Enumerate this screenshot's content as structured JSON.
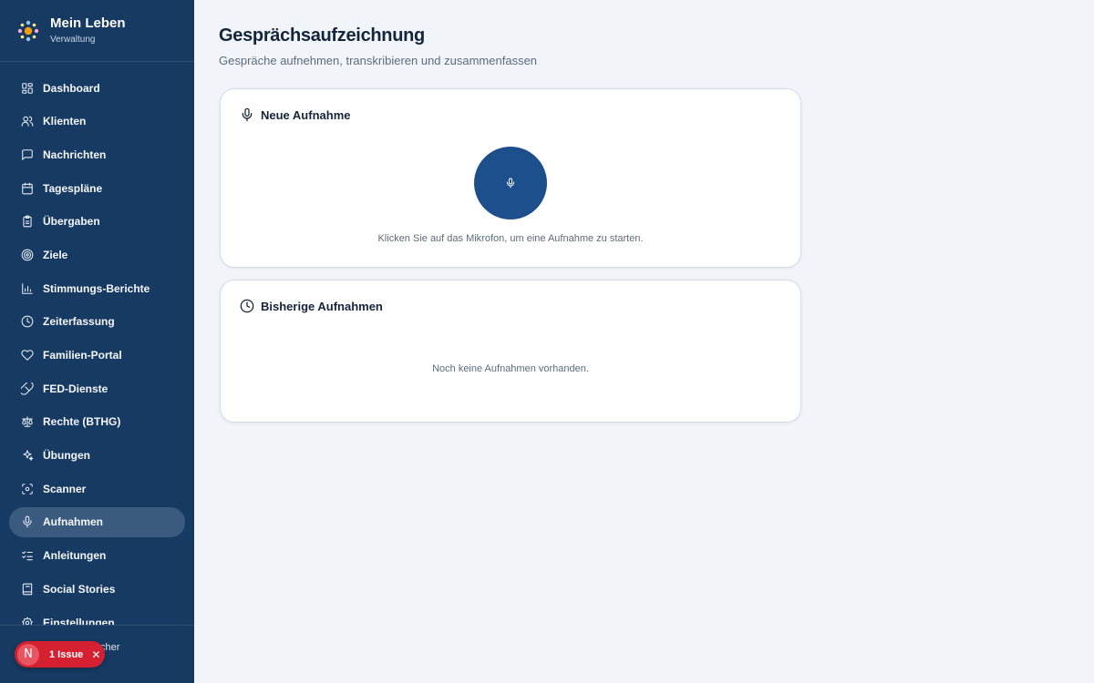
{
  "brand": {
    "title": "Mein Leben",
    "subtitle": "Verwaltung"
  },
  "nav": {
    "items": [
      {
        "label": "Dashboard",
        "icon": "dashboard-icon"
      },
      {
        "label": "Klienten",
        "icon": "users-icon"
      },
      {
        "label": "Nachrichten",
        "icon": "message-icon"
      },
      {
        "label": "Tagespläne",
        "icon": "calendar-icon"
      },
      {
        "label": "Übergaben",
        "icon": "clipboard-icon"
      },
      {
        "label": "Ziele",
        "icon": "target-icon"
      },
      {
        "label": "Stimmungs-Berichte",
        "icon": "bar-chart-icon"
      },
      {
        "label": "Zeiterfassung",
        "icon": "clock-icon"
      },
      {
        "label": "Familien-Portal",
        "icon": "heart-icon"
      },
      {
        "label": "FED-Dienste",
        "icon": "pill-icon"
      },
      {
        "label": "Rechte (BTHG)",
        "icon": "scale-icon"
      },
      {
        "label": "Übungen",
        "icon": "sparkles-icon"
      },
      {
        "label": "Scanner",
        "icon": "scan-icon"
      },
      {
        "label": "Aufnahmen",
        "icon": "microphone-icon",
        "active": true
      },
      {
        "label": "Anleitungen",
        "icon": "list-checks-icon"
      },
      {
        "label": "Social Stories",
        "icon": "book-icon"
      },
      {
        "label": "Einstellungen",
        "icon": "settings-icon"
      }
    ]
  },
  "footer": {
    "text": "cher"
  },
  "issue": {
    "letter": "N",
    "label": "1 Issue",
    "close": "✕"
  },
  "page": {
    "title": "Gesprächsaufzeichnung",
    "subtitle": "Gespräche aufnehmen, transkribieren und zusammenfassen"
  },
  "new_recording": {
    "title": "Neue Aufnahme",
    "hint": "Klicken Sie auf das Mikrofon, um eine Aufnahme zu starten."
  },
  "previous": {
    "title": "Bisherige Aufnahmen",
    "empty": "Noch keine Aufnahmen vorhanden."
  },
  "colors": {
    "sidebar": "#173a62",
    "active_item": "#3a5a80",
    "mic_button": "#1d4f8c",
    "issue_badge": "#d42030",
    "background": "#f1f5f9"
  }
}
